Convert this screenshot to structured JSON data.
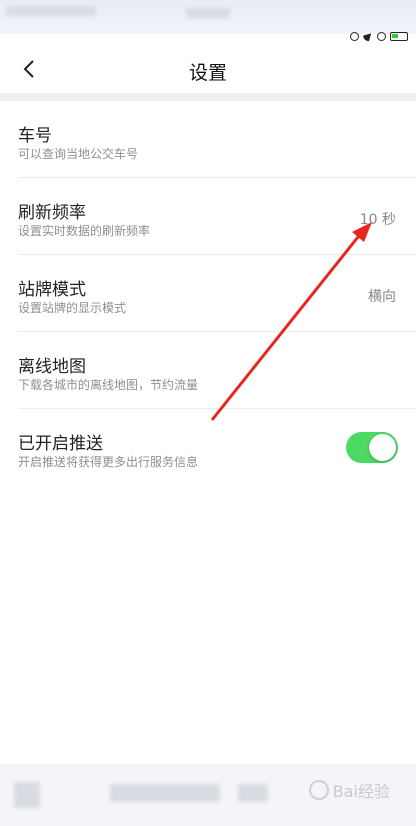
{
  "header": {
    "title": "设置"
  },
  "settings": [
    {
      "title": "车号",
      "subtitle": "可以查询当地公交车号",
      "value": ""
    },
    {
      "title": "刷新频率",
      "subtitle": "设置实时数据的刷新频率",
      "value": "10 秒"
    },
    {
      "title": "站牌模式",
      "subtitle": "设置站牌的显示模式",
      "value": "横向"
    },
    {
      "title": "离线地图",
      "subtitle": "下载各城市的离线地图，节约流量",
      "value": ""
    },
    {
      "title": "已开启推送",
      "subtitle": "开启推送将获得更多出行服务信息",
      "toggle_on": true
    }
  ],
  "watermark": {
    "text": "Bai经验"
  },
  "colors": {
    "toggle_on": "#4cd964",
    "annotation_arrow": "#e8261f"
  }
}
